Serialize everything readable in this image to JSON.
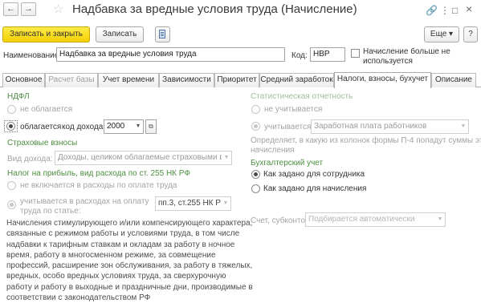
{
  "header": {
    "back_glyph": "←",
    "forward_glyph": "→",
    "star_glyph": "☆",
    "title": "Надбавка за вредные условия труда (Начисление)",
    "link_glyph": "🔗",
    "more_glyph": "⋮",
    "maximize_glyph": "□",
    "close_glyph": "×"
  },
  "toolbar": {
    "save_close_label": "Записать и закрыть",
    "save_label": "Записать",
    "more_label": "Еще ▾",
    "help_label": "?"
  },
  "fields": {
    "name_label": "Наименование:",
    "name_value": "Надбавка за вредные условия труда",
    "code_label": "Код:",
    "code_value": "НВР",
    "not_used_label_1": "Начисление больше не",
    "not_used_label_2": "используется",
    "not_used_checked": false
  },
  "tabs": [
    {
      "label": "Основное",
      "state": "normal"
    },
    {
      "label": "Расчет базы",
      "state": "disabled"
    },
    {
      "label": "Учет времени",
      "state": "normal"
    },
    {
      "label": "Зависимости",
      "state": "normal"
    },
    {
      "label": "Приоритет",
      "state": "normal"
    },
    {
      "label": "Средний заработок",
      "state": "normal"
    },
    {
      "label": "Налоги, взносы, бухучет",
      "state": "active"
    },
    {
      "label": "Описание",
      "state": "normal"
    }
  ],
  "ndfl": {
    "title": "НДФЛ",
    "not_taxed_label": "не облагается",
    "taxed_label": "облагается",
    "income_code_label": "код дохода:",
    "income_code_value": "2000",
    "selected": "taxed"
  },
  "insurance": {
    "title": "Страховые взносы",
    "income_type_label": "Вид дохода:",
    "income_type_value": "Доходы, целиком облагаемые страховыми взносами"
  },
  "profit_tax": {
    "title": "Налог на прибыль, вид расхода по ст. 255 НК РФ",
    "not_included_label": "не включается в расходы по оплате труда",
    "included_label_1": "учитывается в расходах на оплату",
    "included_label_2": "труда по статье:",
    "article_value": "пп.3, ст.255 НК РФ"
  },
  "description": {
    "lines": [
      "Начисления стимулирующего и/или компенсирующего характера,",
      "связанные с режимом работы и условиями труда, в том числе",
      "надбавки к тарифным ставкам и окладам за работу в ночное",
      "время, работу в многосменном режиме, за совмещение",
      "профессий, расширение зон обслуживания, за работу в тяжелых,",
      "вредных, особо вредных условиях труда, за сверхурочную",
      "работу и работу в выходные и праздничные дни, производимые в",
      "соответствии с законодательством РФ"
    ]
  },
  "stat_report": {
    "title": "Статистическая отчетность",
    "not_counted_label": "не учитывается",
    "counted_label": "учитывается",
    "counted_value": "Заработная плата работников",
    "note_line1": "Определяет, в какую из колонок формы П-4 попадут суммы этого",
    "note_line2": "начисления"
  },
  "accounting": {
    "title": "Бухгалтерский учет",
    "as_employee_label": "Как задано для сотрудника",
    "as_accrual_label": "Как задано для начисления",
    "selected": "as_employee",
    "account_label": "Счет, субконто:",
    "account_placeholder": "Подбирается автоматически"
  },
  "colors": {
    "accent_green": "#4c8e3f",
    "primary_button": "#f5d60e"
  }
}
